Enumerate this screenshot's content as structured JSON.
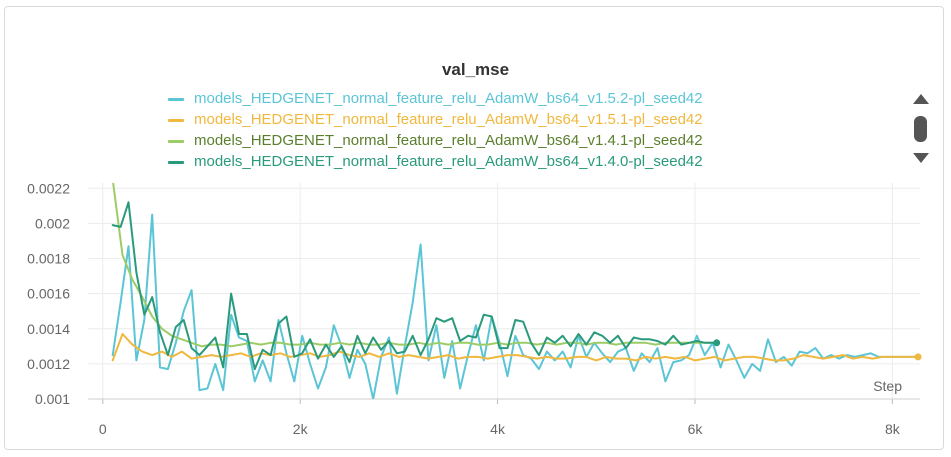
{
  "chart_data": {
    "type": "line",
    "title": "val_mse",
    "xlabel": "Step",
    "ylabel": "",
    "xlim": [
      -150,
      8280
    ],
    "ylim": [
      0.001,
      0.00223
    ],
    "x_ticks": [
      0,
      2000,
      4000,
      6000,
      8000
    ],
    "x_tick_labels": [
      "0",
      "2k",
      "4k",
      "6k",
      "8k"
    ],
    "y_ticks": [
      0.001,
      0.0012,
      0.0014,
      0.0016,
      0.0018,
      0.002,
      0.0022
    ],
    "y_tick_labels": [
      "0.001",
      "0.0012",
      "0.0014",
      "0.0016",
      "0.0018",
      "0.002",
      "0.0022"
    ],
    "grid": true,
    "legend_position": "top",
    "series": [
      {
        "name": "models_HEDGENET_normal_feature_relu_AdamW_bs64_v1.5.2-pl_seed42",
        "color": "#5bc5d6",
        "endpoint_marker": false,
        "x": [
          100,
          180,
          260,
          340,
          420,
          500,
          580,
          660,
          740,
          820,
          900,
          980,
          1060,
          1140,
          1220,
          1300,
          1380,
          1460,
          1540,
          1620,
          1700,
          1780,
          1860,
          1940,
          2020,
          2100,
          2180,
          2260,
          2340,
          2420,
          2500,
          2580,
          2660,
          2740,
          2820,
          2900,
          2980,
          3060,
          3140,
          3220,
          3300,
          3380,
          3460,
          3540,
          3620,
          3700,
          3780,
          3860,
          3940,
          4020,
          4100,
          4180,
          4260,
          4340,
          4420,
          4500,
          4580,
          4660,
          4740,
          4820,
          4900,
          4980,
          5060,
          5140,
          5220,
          5300,
          5380,
          5460,
          5540,
          5620,
          5700,
          5780,
          5860,
          5940,
          6020,
          6100,
          6180,
          6260,
          6340,
          6420,
          6500,
          6580,
          6660,
          6740,
          6820,
          6900,
          6980,
          7060,
          7140,
          7220,
          7300,
          7380,
          7460,
          7540,
          7620,
          7700,
          7780,
          7860,
          7940,
          8020,
          8100,
          8180,
          8260
        ],
        "y": [
          0.00125,
          0.00155,
          0.00187,
          0.00122,
          0.00145,
          0.00205,
          0.00118,
          0.00117,
          0.00132,
          0.0015,
          0.00162,
          0.00105,
          0.00106,
          0.0012,
          0.00105,
          0.00148,
          0.00135,
          0.00133,
          0.0011,
          0.00122,
          0.0011,
          0.00145,
          0.00126,
          0.0011,
          0.00136,
          0.0012,
          0.00106,
          0.00118,
          0.00142,
          0.0013,
          0.00112,
          0.00128,
          0.0012,
          0.001,
          0.00124,
          0.00135,
          0.00103,
          0.0013,
          0.00155,
          0.00188,
          0.00122,
          0.00142,
          0.00112,
          0.00133,
          0.00106,
          0.00125,
          0.00142,
          0.00122,
          0.00147,
          0.00132,
          0.00113,
          0.00136,
          0.00125,
          0.00123,
          0.00117,
          0.00127,
          0.00122,
          0.00127,
          0.00118,
          0.00136,
          0.00124,
          0.00132,
          0.00126,
          0.00121,
          0.00127,
          0.00129,
          0.00116,
          0.00126,
          0.00121,
          0.00129,
          0.0011,
          0.00121,
          0.00122,
          0.00125,
          0.00136,
          0.00125,
          0.00132,
          0.00118,
          0.00131,
          0.00122,
          0.00112,
          0.0012,
          0.00116,
          0.00134,
          0.00121,
          0.00124,
          0.00119,
          0.00127,
          0.00126,
          0.00129,
          0.00123,
          0.00125,
          0.00123,
          0.00125,
          0.00124,
          0.00125,
          0.00126,
          0.00124,
          0.00124,
          0.00124,
          0.00124,
          0.00124,
          0.00124
        ]
      },
      {
        "name": "models_HEDGENET_normal_feature_relu_AdamW_bs64_v1.5.1-pl_seed42",
        "color": "#f0b83e",
        "endpoint_marker": true,
        "x": [
          100,
          200,
          300,
          400,
          500,
          600,
          700,
          800,
          900,
          1000,
          1100,
          1200,
          1300,
          1400,
          1500,
          1600,
          1700,
          1800,
          1900,
          2000,
          2100,
          2200,
          2300,
          2400,
          2500,
          2600,
          2700,
          2800,
          2900,
          3000,
          3100,
          3200,
          3300,
          3400,
          3500,
          3600,
          3700,
          3800,
          3900,
          4000,
          4100,
          4200,
          4300,
          4400,
          4500,
          4600,
          4700,
          4800,
          4900,
          5000,
          5100,
          5200,
          5300,
          5400,
          5500,
          5600,
          5700,
          5800,
          5900,
          6000,
          6100,
          6200,
          6300,
          6400,
          6500,
          6600,
          6700,
          6800,
          6900,
          7000,
          7100,
          7200,
          7300,
          7400,
          7500,
          7600,
          7700,
          7800,
          7900,
          8000,
          8100,
          8200,
          8260
        ],
        "y": [
          0.00122,
          0.00137,
          0.00131,
          0.00127,
          0.00125,
          0.00127,
          0.00124,
          0.00127,
          0.00123,
          0.00124,
          0.00125,
          0.00124,
          0.00125,
          0.00126,
          0.00124,
          0.00126,
          0.00125,
          0.00126,
          0.00124,
          0.00125,
          0.00126,
          0.00124,
          0.00125,
          0.00127,
          0.00125,
          0.00124,
          0.00126,
          0.00124,
          0.00126,
          0.00124,
          0.00125,
          0.00124,
          0.00123,
          0.00124,
          0.00125,
          0.00123,
          0.00124,
          0.00124,
          0.00123,
          0.00124,
          0.00125,
          0.00125,
          0.00124,
          0.00123,
          0.00124,
          0.00123,
          0.00123,
          0.00124,
          0.00124,
          0.00122,
          0.00124,
          0.00123,
          0.00123,
          0.00122,
          0.00124,
          0.00123,
          0.00124,
          0.00123,
          0.00124,
          0.00122,
          0.00123,
          0.00124,
          0.00122,
          0.00123,
          0.00124,
          0.00124,
          0.00123,
          0.00122,
          0.00122,
          0.00123,
          0.00125,
          0.00124,
          0.00123,
          0.00124,
          0.00125,
          0.00123,
          0.00124,
          0.00123,
          0.00124,
          0.00124,
          0.00124,
          0.00124,
          0.00124
        ]
      },
      {
        "name": "models_HEDGENET_normal_feature_relu_AdamW_bs64_v1.4.1-pl_seed42",
        "color": "#9ccc65",
        "endpoint_marker": false,
        "x": [
          100,
          200,
          300,
          400,
          500,
          600,
          700,
          800,
          900,
          1000,
          1100,
          1200,
          1300,
          1400,
          1500,
          1600,
          1700,
          1800,
          1900,
          2000,
          2100,
          2200,
          2300,
          2400,
          2500,
          2600,
          2700,
          2800,
          2900,
          3000,
          3100,
          3200,
          3300,
          3400,
          3500,
          3600,
          3700,
          3800,
          3900,
          4000,
          4100,
          4200,
          4300,
          4400,
          4500,
          4600,
          4700,
          4800,
          4900,
          5000,
          5100,
          5200,
          5300,
          5400,
          5500,
          5600,
          5700,
          5800,
          5900,
          6000,
          6100,
          6200
        ],
        "y": [
          0.00225,
          0.00182,
          0.00168,
          0.00158,
          0.00147,
          0.0014,
          0.00136,
          0.00134,
          0.00132,
          0.0013,
          0.00131,
          0.00131,
          0.0013,
          0.00131,
          0.00132,
          0.00131,
          0.00132,
          0.00132,
          0.00131,
          0.00131,
          0.00132,
          0.00131,
          0.00131,
          0.00132,
          0.00131,
          0.00132,
          0.00131,
          0.00131,
          0.00132,
          0.00131,
          0.00131,
          0.00132,
          0.00131,
          0.00132,
          0.00131,
          0.00132,
          0.00132,
          0.00131,
          0.00131,
          0.00132,
          0.00131,
          0.00132,
          0.00132,
          0.00131,
          0.00132,
          0.00131,
          0.00132,
          0.00132,
          0.00131,
          0.00132,
          0.00132,
          0.00131,
          0.00132,
          0.00132,
          0.00132,
          0.00131,
          0.00132,
          0.00132,
          0.00132,
          0.00132,
          0.00132,
          0.00132
        ]
      },
      {
        "name": "models_HEDGENET_normal_feature_relu_AdamW_bs64_v1.4.0-pl_seed42",
        "color": "#2a9a7c",
        "endpoint_marker": true,
        "x": [
          100,
          180,
          260,
          340,
          420,
          500,
          580,
          660,
          740,
          820,
          900,
          980,
          1060,
          1140,
          1220,
          1300,
          1380,
          1460,
          1540,
          1620,
          1700,
          1780,
          1860,
          1940,
          2020,
          2100,
          2180,
          2260,
          2340,
          2420,
          2500,
          2580,
          2660,
          2740,
          2820,
          2900,
          2980,
          3060,
          3140,
          3220,
          3300,
          3380,
          3460,
          3540,
          3620,
          3700,
          3780,
          3860,
          3940,
          4020,
          4100,
          4180,
          4260,
          4340,
          4420,
          4500,
          4580,
          4660,
          4740,
          4820,
          4900,
          4980,
          5060,
          5140,
          5220,
          5300,
          5380,
          5460,
          5540,
          5620,
          5700,
          5780,
          5860,
          5940,
          6020,
          6100,
          6180,
          6220
        ],
        "y": [
          0.00199,
          0.00198,
          0.00212,
          0.00172,
          0.00148,
          0.00158,
          0.00138,
          0.00125,
          0.00141,
          0.00145,
          0.00129,
          0.00125,
          0.0013,
          0.00135,
          0.00118,
          0.0016,
          0.00137,
          0.00137,
          0.00117,
          0.00128,
          0.00125,
          0.00143,
          0.00147,
          0.00124,
          0.00126,
          0.00134,
          0.00123,
          0.00131,
          0.00124,
          0.0013,
          0.00121,
          0.00136,
          0.00126,
          0.00135,
          0.00128,
          0.00133,
          0.00126,
          0.00127,
          0.00136,
          0.00125,
          0.00134,
          0.00146,
          0.00144,
          0.00146,
          0.00133,
          0.00136,
          0.00135,
          0.00148,
          0.00147,
          0.00129,
          0.00129,
          0.00145,
          0.00144,
          0.00132,
          0.00125,
          0.00135,
          0.00132,
          0.00136,
          0.0013,
          0.00137,
          0.00131,
          0.00138,
          0.00136,
          0.00132,
          0.00136,
          0.00129,
          0.00135,
          0.00134,
          0.00134,
          0.00133,
          0.00131,
          0.00136,
          0.00131,
          0.00132,
          0.00133,
          0.00132,
          0.00132,
          0.00132
        ]
      }
    ]
  }
}
